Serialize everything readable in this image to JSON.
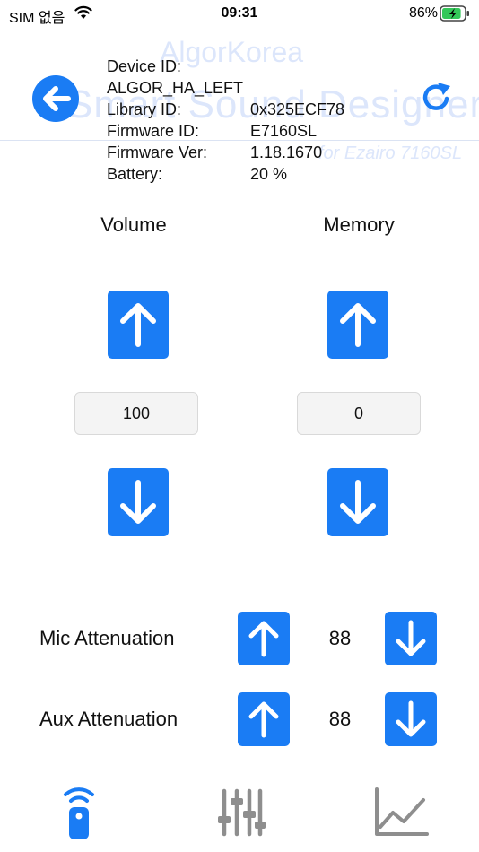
{
  "status": {
    "carrier": "SIM 없음",
    "time": "09:31",
    "battery_pct": "86%",
    "battery_level": 0.86
  },
  "watermark": {
    "line1": "AlgorKorea",
    "line2": "Smart Sound Designer",
    "line3": "for Ezairo 7160SL"
  },
  "device": {
    "device_id_label": "Device ID:",
    "device_id_value": "ALGOR_HA_LEFT",
    "library_id_label": "Library ID:",
    "library_id_value": "0x325ECF78",
    "firmware_id_label": "Firmware ID:",
    "firmware_id_value": "E7160SL",
    "firmware_ver_label": "Firmware Ver:",
    "firmware_ver_value": "1.18.1670",
    "battery_label": "Battery:",
    "battery_value": "20 %"
  },
  "volume": {
    "title": "Volume",
    "value": "100"
  },
  "memory": {
    "title": "Memory",
    "value": "0"
  },
  "mic_attenuation": {
    "label": "Mic Attenuation",
    "value": "88"
  },
  "aux_attenuation": {
    "label": "Aux Attenuation",
    "value": "88"
  },
  "colors": {
    "accent": "#1a7cf4",
    "tab_inactive": "#8e8e8e"
  },
  "icons": {
    "back": "arrow-left-circle-icon",
    "refresh": "refresh-icon",
    "up": "arrow-up-icon",
    "down": "arrow-down-icon",
    "tabs": [
      "remote-control-icon",
      "sliders-icon",
      "line-chart-icon"
    ]
  }
}
